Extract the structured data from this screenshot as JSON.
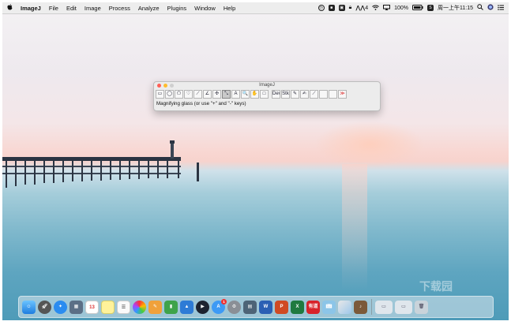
{
  "menubar": {
    "apple": "",
    "app_name": "ImageJ",
    "items": [
      "File",
      "Edit",
      "Image",
      "Process",
      "Analyze",
      "Plugins",
      "Window",
      "Help"
    ],
    "status": {
      "battery": "100%",
      "input_indicator": "4",
      "datetime": "周一上午11:15"
    }
  },
  "imagej": {
    "title": "ImageJ",
    "tools": [
      "▭",
      "◯",
      "⬠",
      "♡",
      "⟋",
      "∠",
      "✣",
      "⤡",
      "A",
      "🔍",
      "✋",
      "□",
      "Dev",
      "Stk",
      "✎",
      "✍",
      "⟋",
      "",
      "",
      "≫"
    ],
    "status": "Magnifying glass (or use \"+\" and \"-\" keys)"
  },
  "dock": {
    "calendar_day": "13",
    "app_store_badge": "1",
    "word_letter": "W",
    "powerpoint_letter": "P",
    "excel_letter": "X",
    "youdao_label": "有道"
  },
  "watermark": "下载园",
  "colors": {
    "menubar_bg": "#ececec",
    "close": "#ff5f57",
    "minimize": "#febc2e",
    "zoom": "#28c840"
  }
}
